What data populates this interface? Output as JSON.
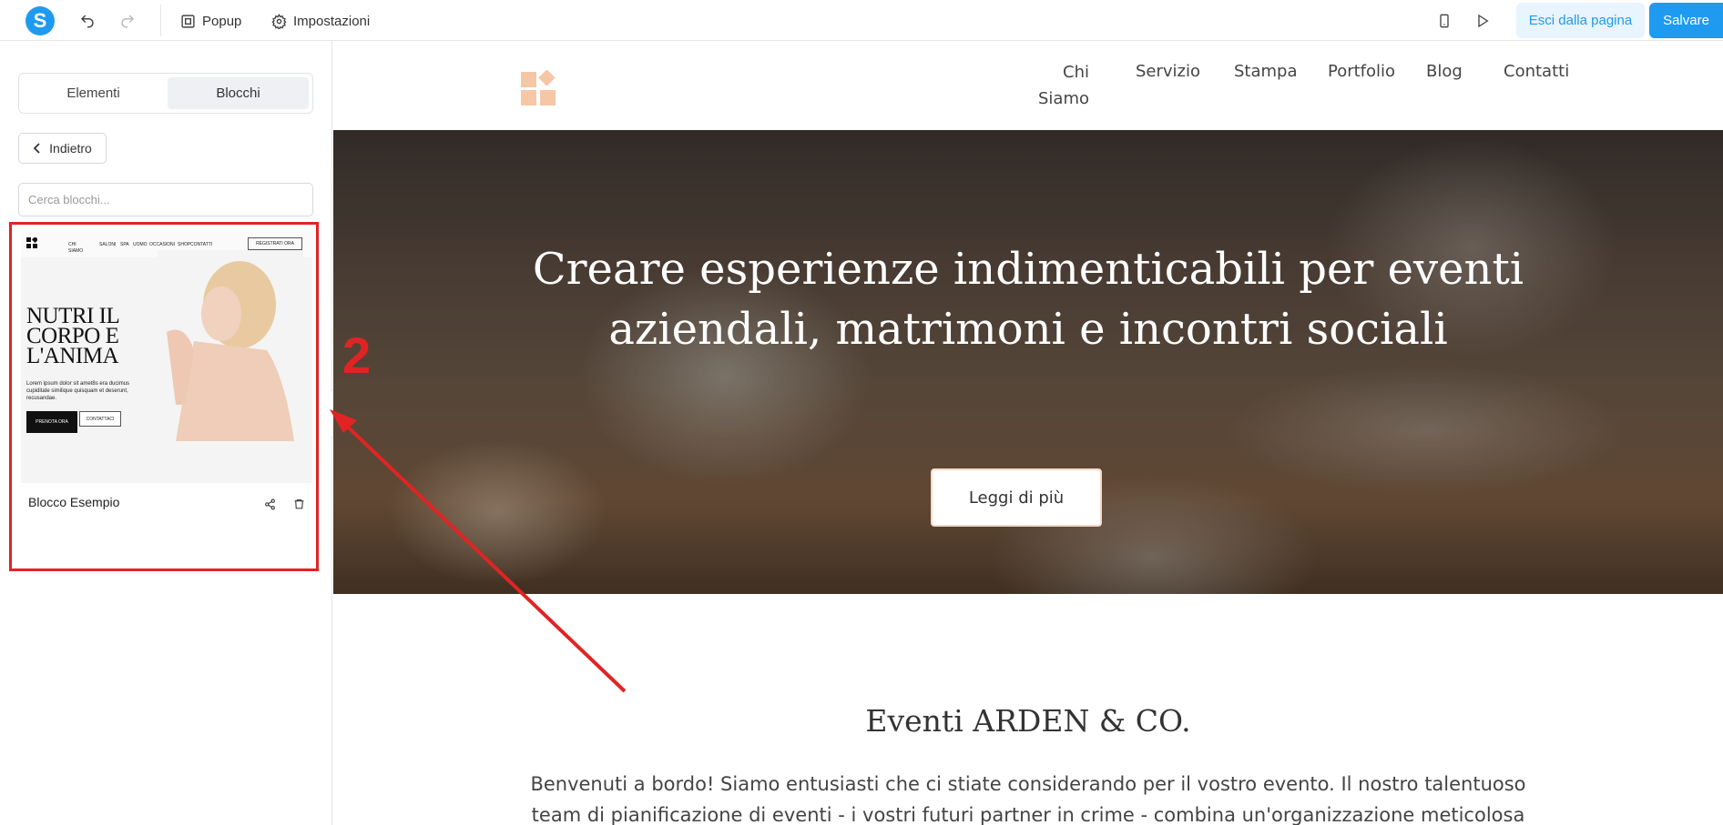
{
  "toolbar": {
    "popup_label": "Popup",
    "settings_label": "Impostazioni",
    "exit_label": "Esci dalla pagina",
    "save_label": "Salvare"
  },
  "leftpanel": {
    "tabs": [
      {
        "label": "Elementi",
        "active": false
      },
      {
        "label": "Blocchi",
        "active": true
      }
    ],
    "back_label": "Indietro",
    "search_placeholder": "Cerca blocchi...",
    "block": {
      "label": "Blocco Esempio",
      "preview": {
        "nav": [
          "CHI SIAMO",
          "SALONI",
          "SPA",
          "UOMO",
          "OCCASIONI",
          "SHOP",
          "CONTATTI"
        ],
        "cta": "REGISTRATI ORA",
        "title_lines": [
          "NUTRI IL",
          "CORPO E",
          "L'ANIMA"
        ],
        "lorem": "Lorem ipsum dolor sit amet8s era ducimus cupiditate similique quisquam et deserunt, recusandae.",
        "btn_primary": "PRENOTA ORA",
        "btn_secondary": "CONTATTACI"
      }
    }
  },
  "site": {
    "nav": [
      "Chi Siamo",
      "Servizio",
      "Stampa",
      "Portfolio",
      "Blog",
      "Contatti"
    ],
    "hero_title": "Creare esperienze indimenticabili per eventi aziendali, matrimoni e incontri sociali",
    "hero_button": "Leggi di più",
    "section_title": "Eventi ARDEN & CO.",
    "section_text": "Benvenuti a bordo! Siamo entusiasti che ci stiate considerando per il vostro evento. Il nostro talentuoso team di pianificazione di eventi - i vostri futuri partner in crime - combina un'organizzazione meticolosa con"
  },
  "annotation": {
    "number": "2",
    "color": "#e02424"
  },
  "colors": {
    "accent": "#1e9bf0",
    "logo_peach": "#f5c7a6"
  }
}
